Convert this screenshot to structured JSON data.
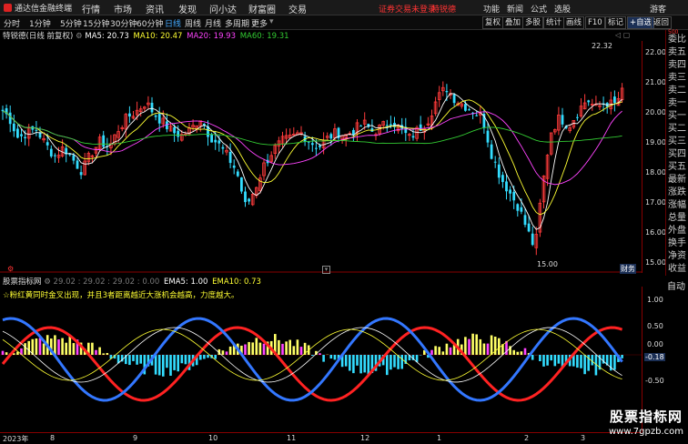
{
  "app": {
    "title": "通达信金融终端",
    "logo_color": "#dd2222"
  },
  "menu": [
    "行情",
    "市场",
    "资讯",
    "发现",
    "问小达",
    "财富圈",
    "交易"
  ],
  "top_links": {
    "security": "证券交易未登录",
    "stock_name": "特锐德"
  },
  "top_right_menu": [
    "功能",
    "新闻",
    "公式",
    "选股",
    "游客"
  ],
  "period_tabs": [
    "分时",
    "1分钟",
    "5分钟",
    "15分钟",
    "30分钟",
    "60分钟",
    "日线",
    "周线",
    "月线",
    "多周期",
    "更多"
  ],
  "active_period": "日线",
  "tools": [
    "复权",
    "叠加",
    "多股",
    "统计",
    "画线",
    "F10",
    "标记",
    "+自选",
    "返回"
  ],
  "main_info": {
    "stock": "特锐德(日线 前复权)",
    "ma5": "MA5: 20.73",
    "ma10": "MA10: 20.47",
    "ma20": "MA20: 19.93",
    "ma60": "MA60: 19.31"
  },
  "price_axis": [
    "22.00",
    "21.00",
    "20.00",
    "19.00",
    "18.00",
    "17.00",
    "16.00",
    "15.00"
  ],
  "price_marker_high": "22.32",
  "price_marker_low": "15.00",
  "right_tag": "财务",
  "right_panel": [
    "委比",
    "卖五",
    "卖四",
    "卖三",
    "卖二",
    "卖一",
    "买一",
    "买二",
    "买三",
    "买四",
    "买五",
    "最新",
    "涨跌",
    "涨幅",
    "总量",
    "外盘",
    "换手",
    "净资",
    "收益"
  ],
  "price_top_value": "500",
  "indicator": {
    "name": "股票指标网",
    "values": "29.02 : 29.02 : 29.02 : 0.00",
    "ema5": "EMA5: 1.00",
    "ema10": "EMA10: 0.73",
    "note": "☆粉红黄同时金叉出现，并且3者距离越近大涨机会越高，力度越大。",
    "axis": [
      "1.00",
      "0.50",
      "0.00",
      "-0.18",
      "-0.50",
      "-1.00"
    ],
    "auto": "自动"
  },
  "date_axis": [
    "2023年",
    "8",
    "9",
    "10",
    "11",
    "12",
    "1",
    "2",
    "3"
  ],
  "watermark": {
    "line1": "股票指标网",
    "line2": "www.7gpzb.com"
  },
  "colors": {
    "up": "#ff3b3b",
    "down": "#33ddff",
    "ma5": "#ffffff",
    "ma10": "#ffff33",
    "ma20": "#ff44ff",
    "ma60": "#33cc33"
  }
}
